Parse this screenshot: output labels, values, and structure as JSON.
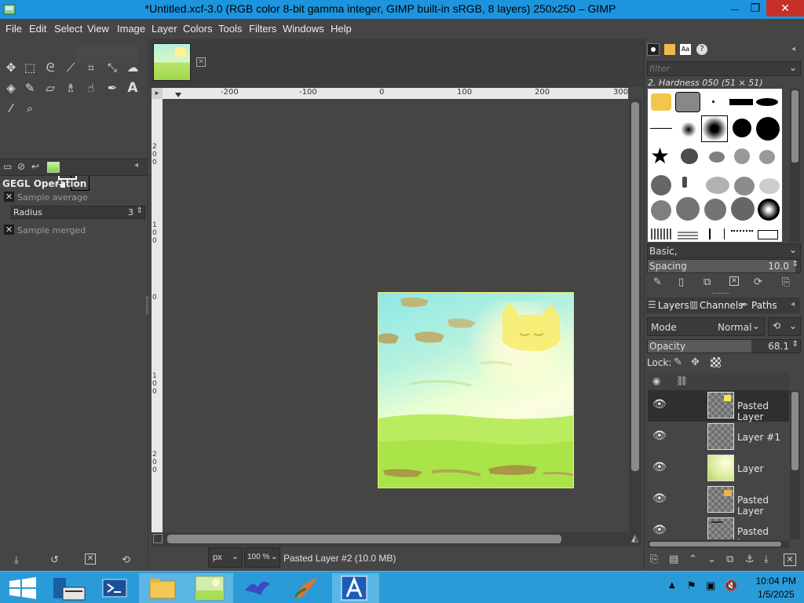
{
  "window": {
    "title": "*Untitled.xcf-3.0 (RGB color 8-bit gamma integer, GIMP built-in sRGB, 8 layers) 250x250 – GIMP",
    "controls": {
      "minimize": "—",
      "restore": "❐",
      "close": "✕"
    }
  },
  "menu": [
    "File",
    "Edit",
    "Select",
    "View",
    "Image",
    "Layer",
    "Colors",
    "Tools",
    "Filters",
    "Windows",
    "Help"
  ],
  "toolbox": {
    "tools": [
      "move-tool",
      "rect-select-tool",
      "free-select-tool",
      "fuzzy-select-tool",
      "crop-tool",
      "transform-tool",
      "warp-tool",
      "bucket-fill-tool",
      "paintbrush-tool",
      "eraser-tool",
      "clone-tool",
      "smudge-tool",
      "paths-tool",
      "text-tool",
      "color-picker-tool",
      "zoom-tool"
    ],
    "fg_color": "#000000",
    "bg_color": "#ffffff"
  },
  "tool_options": {
    "heading": "GEGL Operation",
    "sample_average": "Sample average",
    "radius_label": "Radius",
    "radius_value": "3",
    "sample_merged": "Sample merged",
    "footer_icons": [
      "save-icon",
      "restore-icon",
      "delete-icon",
      "reset-icon"
    ]
  },
  "rulers": {
    "horizontal_ticks": [
      "-200",
      "-100",
      "0",
      "100",
      "200",
      "300"
    ],
    "vertical_ticks": [
      "2 0 0",
      "1 0 0",
      "0",
      "1 0 0",
      "2 0 0"
    ]
  },
  "status": {
    "unit": "px",
    "zoom": "100 %",
    "message": "Pasted Layer #2 (10.0 MB)"
  },
  "brushes": {
    "filter_placeholder": "filter",
    "current": "2. Hardness 050 (51 × 51)",
    "tag": "Basic,",
    "spacing_label": "Spacing",
    "spacing_value": "10.0"
  },
  "layers_panel": {
    "tabs": [
      "Layers",
      "Channels",
      "Paths"
    ],
    "mode_label": "Mode",
    "mode_value": "Normal",
    "opacity_label": "Opacity",
    "opacity_value": "68.1",
    "opacity_fraction": 0.681,
    "lock_label": "Lock:",
    "layers": [
      {
        "name": "Pasted Layer",
        "selected": true
      },
      {
        "name": "Layer #1",
        "selected": false
      },
      {
        "name": "Layer",
        "selected": false
      },
      {
        "name": "Pasted Layer",
        "selected": false
      },
      {
        "name": "Pasted Layer",
        "selected": false
      }
    ]
  },
  "taskbar": {
    "apps": [
      "start",
      "server-manager",
      "powershell",
      "file-explorer",
      "gimp",
      "inkscape-bird",
      "paint-brush",
      "arc-app"
    ],
    "time": "10:04 PM",
    "date": "1/5/2025"
  }
}
